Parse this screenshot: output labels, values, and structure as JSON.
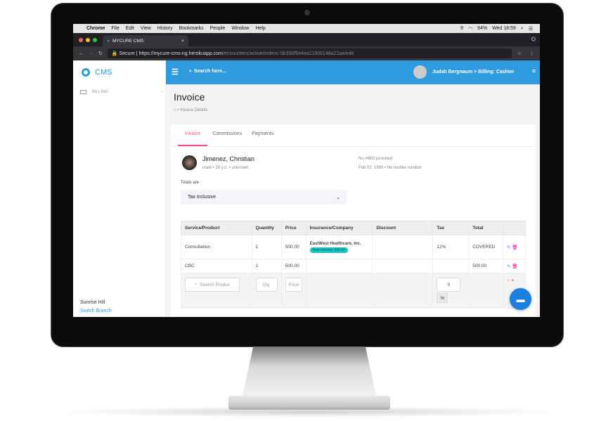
{
  "os_menu": {
    "apple": "",
    "app": "Chrome",
    "items": [
      "File",
      "Edit",
      "View",
      "History",
      "Bookmarks",
      "People",
      "Window",
      "Help"
    ],
    "status": [
      "9",
      "94%",
      "Wed 18:59"
    ]
  },
  "browser": {
    "tab_title": "MYCURE CMS",
    "close": "×",
    "secure": "Secure",
    "url_host": "https://mycure-cms-ng.herokuapp.com",
    "url_path": "/encounters/active/mdenc-5b330f5e4ea11500148a22aa/edit"
  },
  "sidebar": {
    "logo": "CMS",
    "items": [
      {
        "label": "BILLING",
        "icon": "credit-card-icon"
      }
    ],
    "branch": "Sunrise Hill",
    "switch_branch": "Switch Branch"
  },
  "topbar": {
    "search_placeholder": "Search here...",
    "user": "Judah Bergnaum > Billing: Cashier"
  },
  "page": {
    "title": "Invoice",
    "breadcrumb": "Invoice Details"
  },
  "tabs": [
    {
      "label": "Invoice",
      "active": true
    },
    {
      "label": "Commissions"
    },
    {
      "label": "Payments"
    }
  ],
  "patient": {
    "name": "Jimenez, Christian",
    "sex": "male",
    "age": "28 y.o.",
    "status": "unknown",
    "hmo": "No HMO provided",
    "dob": "Feb 02, 1990",
    "mobile": "No mobile number"
  },
  "totals": {
    "label": "Totals are",
    "value": "Tax Inclusive"
  },
  "table": {
    "headers": [
      "Service/Product",
      "Quantity",
      "Price",
      "Insurance/Company",
      "Discount",
      "Tax",
      "Total",
      ""
    ],
    "rows": [
      {
        "service": "Consultation",
        "qty": "1",
        "price": "500.00",
        "insurance": "EastWest Healthcare, Inc.",
        "badge": "New amount: 399.00",
        "discount": "",
        "tax": "12%",
        "total": "COVERED"
      },
      {
        "service": "CBC",
        "qty": "1",
        "price": "500.00",
        "insurance": "",
        "badge": "",
        "discount": "",
        "tax": "",
        "total": "500.00"
      }
    ],
    "new_row": {
      "search_placeholder": "Search Produc",
      "qty_placeholder": "Qty.",
      "price_placeholder": "Price",
      "tax_value": "0",
      "tax_unit": "%"
    }
  },
  "colors": {
    "primary": "#2e9bde",
    "active_tab": "#f0517f",
    "badge": "#20c4c4"
  }
}
